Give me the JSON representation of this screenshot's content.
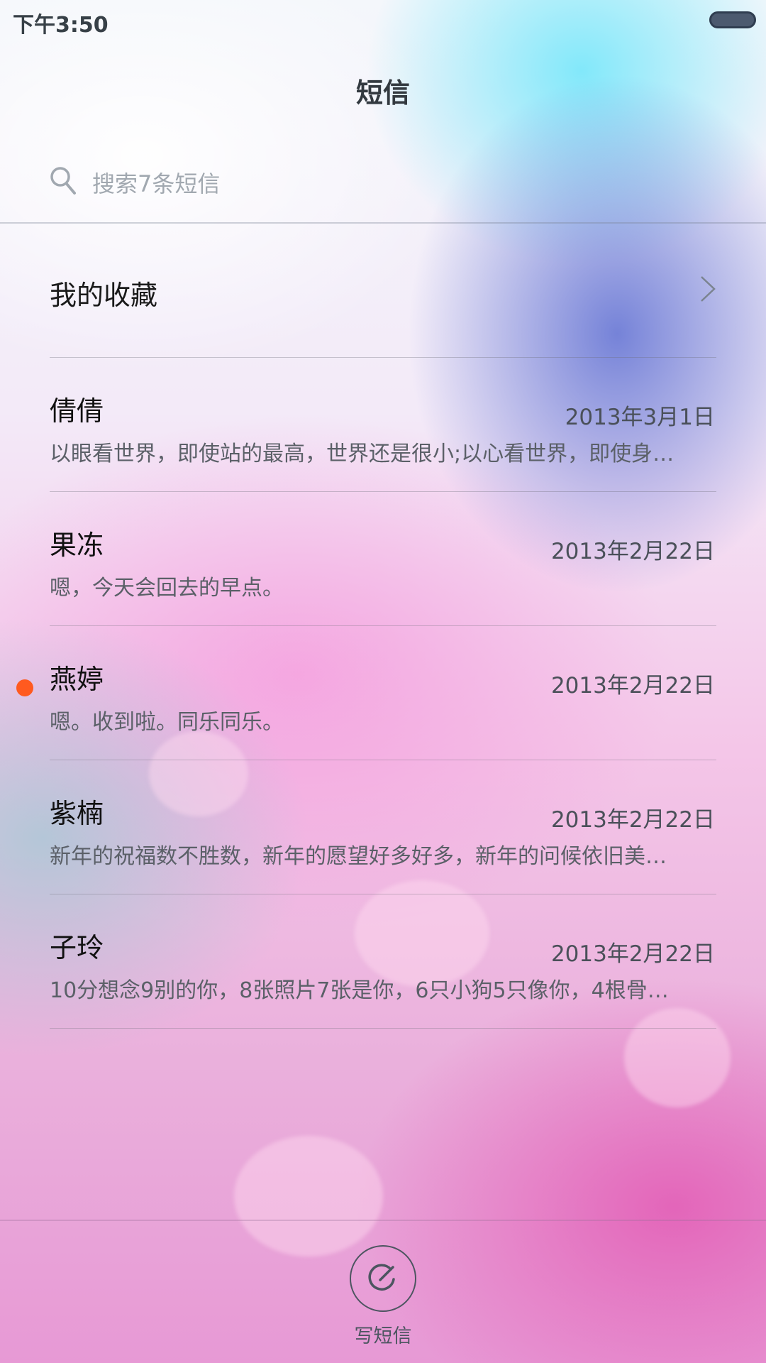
{
  "status_bar": {
    "time": "下午3:50"
  },
  "header": {
    "title": "短信"
  },
  "search": {
    "placeholder": "搜索7条短信",
    "icon": "search-icon"
  },
  "favorites": {
    "label": "我的收藏",
    "icon": "chevron-right-icon"
  },
  "conversations": [
    {
      "name": "倩倩",
      "date": "2013年3月1日",
      "preview": "以眼看世界，即使站的最高，世界还是很小;以心看世界，即使身…",
      "unread": false
    },
    {
      "name": "果冻",
      "date": "2013年2月22日",
      "preview": "嗯，今天会回去的早点。",
      "unread": false
    },
    {
      "name": "燕婷",
      "date": "2013年2月22日",
      "preview": "嗯。收到啦。同乐同乐。",
      "unread": true
    },
    {
      "name": "紫楠",
      "date": "2013年2月22日",
      "preview": "新年的祝福数不胜数，新年的愿望好多好多，新年的问候依旧美…",
      "unread": false
    },
    {
      "name": "子玲",
      "date": "2013年2月22日",
      "preview": "10分想念9别的你，8张照片7张是你，6只小狗5只像你，4根骨…",
      "unread": false
    }
  ],
  "compose": {
    "label": "写短信",
    "icon": "compose-icon"
  },
  "colors": {
    "unread_dot": "#ff5a1f",
    "title_text": "#333a40",
    "secondary_text": "#5b6068"
  }
}
